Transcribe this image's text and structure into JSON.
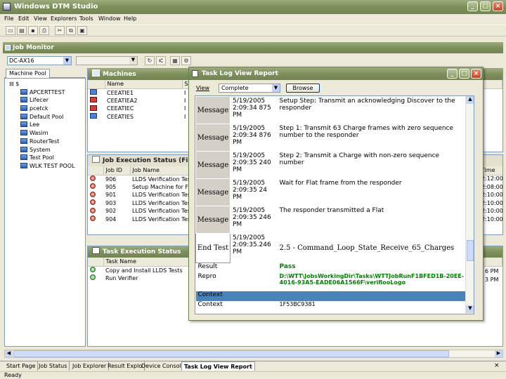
{
  "app": {
    "title": "Windows DTM Studio"
  },
  "menu": [
    "File",
    "Edit",
    "View",
    "Explorers",
    "Tools",
    "Window",
    "Help"
  ],
  "job_monitor": {
    "title": "Job Monitor",
    "combo_value": "DC-AX16"
  },
  "left_tabs": {
    "active": "Machine Pool"
  },
  "tree": {
    "root": "$",
    "items": [
      "APCERTTEST",
      "Lifecer",
      "pcetck",
      "Default Pool",
      "Lee",
      "Wasim",
      "RouterTest",
      "System",
      "Test Pool",
      "WLK TEST POOL"
    ]
  },
  "machines": {
    "title": "Machines",
    "headers": [
      "Name",
      "St"
    ],
    "rows": [
      "CEEATIE1",
      "CEEATIEA2",
      "CEEATIEC",
      "CEEATIES"
    ],
    "status": [
      "I",
      "I",
      "I",
      "I"
    ]
  },
  "job_exec": {
    "title": "Job Execution Status (Filte",
    "headers": [
      "Job ID",
      "Job Name"
    ],
    "rows": [
      {
        "id": "906",
        "name": "LLDS Verification Tests"
      },
      {
        "id": "905",
        "name": "Setup Machine for Fou"
      },
      {
        "id": "901",
        "name": "LLDS Verification Test"
      },
      {
        "id": "903",
        "name": "LLDS Verification Test"
      },
      {
        "id": "902",
        "name": "LLDS Verification Test"
      },
      {
        "id": "904",
        "name": "LLDS Verification Test"
      }
    ],
    "right_header": "Time",
    "right_times": [
      "2:12:00",
      "2:08:00",
      "2:10:00",
      "2:10:00",
      "2:10:00",
      "2:10:00"
    ]
  },
  "task_exec": {
    "title": "Task Execution Status",
    "header": "Task Name",
    "rows": [
      "Copy and Install LLDS Tests",
      "Run Verifier"
    ],
    "right_times": [
      "6 PM",
      "3 PM"
    ]
  },
  "dialog": {
    "title": "Task Log View Report",
    "view_label": "View",
    "view_value": "Complete",
    "browse_label": "Browse",
    "log": [
      {
        "key": "Message",
        "date": "5/19/2005 2:09:34 875 PM",
        "text": "Setup Step: Transmit an acknowledging Discover to the responder"
      },
      {
        "key": "Message",
        "date": "5/19/2005 2:09:34 876 PM",
        "text": "Step 1: Transmit 63 Charge frames with zero sequence number to the responder"
      },
      {
        "key": "Message",
        "date": "5/19/2005 2:09:35 240 PM",
        "text": "Step 2: Transmit a Charge with non-zero sequence number"
      },
      {
        "key": "Message",
        "date": "5/19/2005 2:09:35 24 PM",
        "text": "Wait for Flat frame from the responder"
      },
      {
        "key": "Message",
        "date": "5/19/2005 2:09:35 246 PM",
        "text": "The responder transmitted a Flat"
      }
    ],
    "end": {
      "key": "End Test",
      "date": "5/19/2005 2:09:35.246 PM",
      "text": "2.5 - Command_Loop_State_Receive_65_Charges"
    },
    "result": {
      "key": "Result",
      "value": "Pass"
    },
    "repro": {
      "key": "Repro",
      "value": "D:\\WTT\\JobsWorkingDir\\Tasks\\WTTJobRunF1BFED1B-20EE-4016-93A5-EADE06A1566F\\verifiooLogo"
    },
    "context": {
      "header": "Context",
      "key": "Context",
      "value": "1F53BC9381"
    }
  },
  "bottom_tabs": [
    "Start Page",
    "Job Status",
    "Job Explorer",
    "Result Explo",
    "Device Console",
    "Task Log View Report"
  ],
  "bottom_active": 5,
  "status": {
    "text": "Ready"
  },
  "colors": {
    "title_bar": "#7d8f5c",
    "context_blue": "#4b82b8",
    "result_green": "#008000"
  }
}
